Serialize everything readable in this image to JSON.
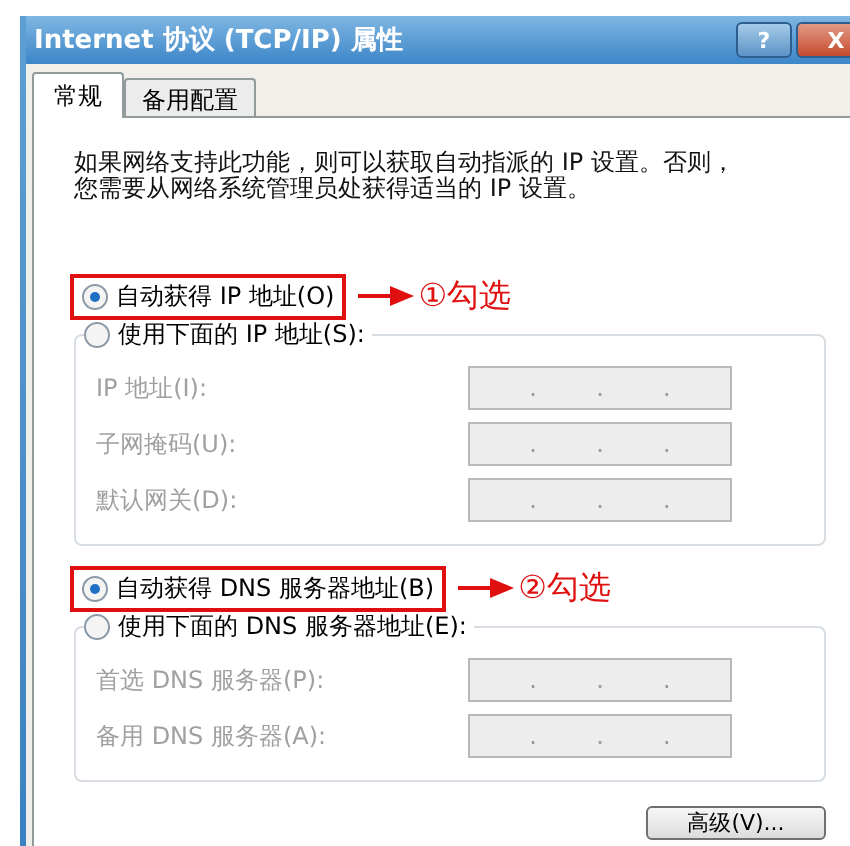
{
  "window": {
    "title": "Internet 协议 (TCP/IP) 属性",
    "help_button": "?",
    "close_button": "X"
  },
  "tabs": [
    {
      "label": "常规",
      "selected": true
    },
    {
      "label": "备用配置",
      "selected": false
    }
  ],
  "description_lines": [
    "如果网络支持此功能，则可以获取自动指派的 IP 设置。否则，",
    "您需要从网络系统管理员处获得适当的 IP 设置。"
  ],
  "sections": [
    {
      "auto": {
        "label": "自动获得 IP 地址(O)",
        "selected": true,
        "annotation": "①勾选"
      },
      "manual": {
        "label": "使用下面的 IP 地址(S):",
        "selected": false
      },
      "fields": [
        {
          "label": "IP 地址(I):",
          "disabled": true,
          "dots": [
            ".",
            ".",
            "."
          ]
        },
        {
          "label": "子网掩码(U):",
          "disabled": true,
          "dots": [
            ".",
            ".",
            "."
          ]
        },
        {
          "label": "默认网关(D):",
          "disabled": true,
          "dots": [
            ".",
            ".",
            "."
          ]
        }
      ]
    },
    {
      "auto": {
        "label": "自动获得 DNS 服务器地址(B)",
        "selected": true,
        "annotation": "②勾选"
      },
      "manual": {
        "label": "使用下面的 DNS 服务器地址(E):",
        "selected": false
      },
      "fields": [
        {
          "label": "首选 DNS 服务器(P):",
          "disabled": true,
          "dots": [
            ".",
            ".",
            "."
          ]
        },
        {
          "label": "备用 DNS 服务器(A):",
          "disabled": true,
          "dots": [
            ".",
            ".",
            "."
          ]
        }
      ]
    }
  ],
  "advanced_button": "高级(V)..."
}
